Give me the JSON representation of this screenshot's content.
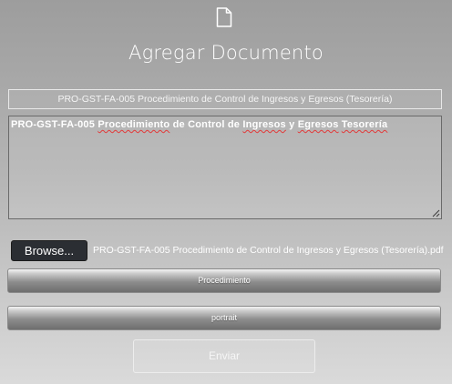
{
  "header": {
    "icon": "document-icon",
    "title": "Agregar Documento"
  },
  "form": {
    "title_field": {
      "value": "PRO-GST-FA-005 Procedimiento de Control de Ingresos y Egresos (Tesorería)"
    },
    "description_field": {
      "words": [
        "PRO-GST-FA-005",
        "Procedimiento",
        "de",
        "Control",
        "de",
        "Ingresos",
        "y",
        "Egresos",
        "Tesorería"
      ]
    },
    "file_input": {
      "button_label": "Browse...",
      "file_name": "PRO-GST-FA-005 Procedimiento de Control de Ingresos y Egresos (Tesorería).pdf"
    },
    "type_select": {
      "selected": "Procedimiento"
    },
    "orientation_select": {
      "selected": "portrait"
    },
    "submit_label": "Enviar"
  }
}
